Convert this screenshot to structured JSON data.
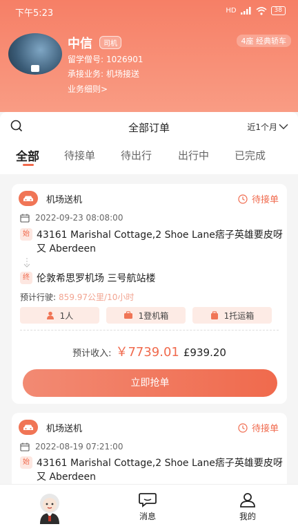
{
  "status": {
    "time": "下午5:23",
    "network": "HD",
    "battery": "38"
  },
  "profile": {
    "name": "中信",
    "role_tag": "司机",
    "car_tag": "4座 经典轿车",
    "id_label": "留学僧号:",
    "id_value": "1026901",
    "biz_label": "承接业务:",
    "biz_value": "机场接送",
    "rules_link": "业务细则>"
  },
  "filter": {
    "title": "全部订单",
    "period": "近1个月"
  },
  "tabs": [
    {
      "label": "全部"
    },
    {
      "label": "待接单"
    },
    {
      "label": "待出行"
    },
    {
      "label": "出行中"
    },
    {
      "label": "已完成"
    }
  ],
  "orders": [
    {
      "type": "机场送机",
      "status": "待接单",
      "date": "2022-09-23 08:08:00",
      "start_marker": "始",
      "start": "43161 Marishal Cottage,2 Shoe Lane痞子英雄要皮呀又 Aberdeen",
      "end_marker": "终",
      "end": "伦敦希思罗机场 三号航站楼",
      "est_label": "预计行驶:",
      "est_value": "859.97公里/10小时",
      "pax": "1人",
      "cabin": "1登机箱",
      "checked": "1托运箱",
      "income_label": "预计收入:",
      "income_cny": "￥7739.01",
      "income_gbp": "£939.20",
      "button": "立即抢单"
    },
    {
      "type": "机场送机",
      "status": "待接单",
      "date": "2022-08-19 07:21:00",
      "start_marker": "始",
      "start": "43161 Marishal Cottage,2 Shoe Lane痞子英雄要皮呀又 Aberdeen"
    }
  ],
  "nav": {
    "messages": "消息",
    "mine": "我的"
  },
  "colors": {
    "accent": "#f06a4d",
    "header_top": "#f67f66",
    "header_bottom": "#f99c84"
  }
}
